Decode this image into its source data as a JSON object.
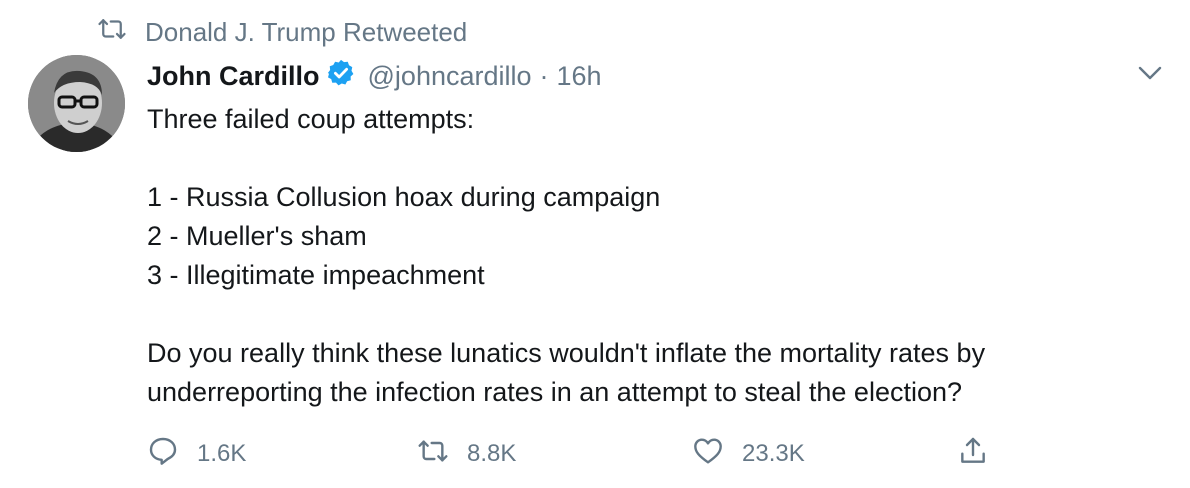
{
  "retweet_banner": {
    "text": "Donald J. Trump Retweeted",
    "icon": "retweet-icon"
  },
  "tweet": {
    "author": {
      "name": "John Cardillo",
      "verified": true,
      "handle": "@johncardillo",
      "avatar_icon": "avatar-photo"
    },
    "separator": "·",
    "time": "16h",
    "body": "Three failed coup attempts:\n\n1 - Russia Collusion hoax during campaign\n2 - Mueller's sham\n3 - Illegitimate impeachment\n\nDo you really think these lunatics wouldn't inflate the mortality rates by underreporting the infection rates in an attempt to steal the election?",
    "actions": {
      "reply_count": "1.6K",
      "retweet_count": "8.8K",
      "like_count": "23.3K"
    }
  },
  "colors": {
    "text": "#14171a",
    "secondary": "#657786",
    "verified": "#1da1f2",
    "background": "#ffffff"
  }
}
